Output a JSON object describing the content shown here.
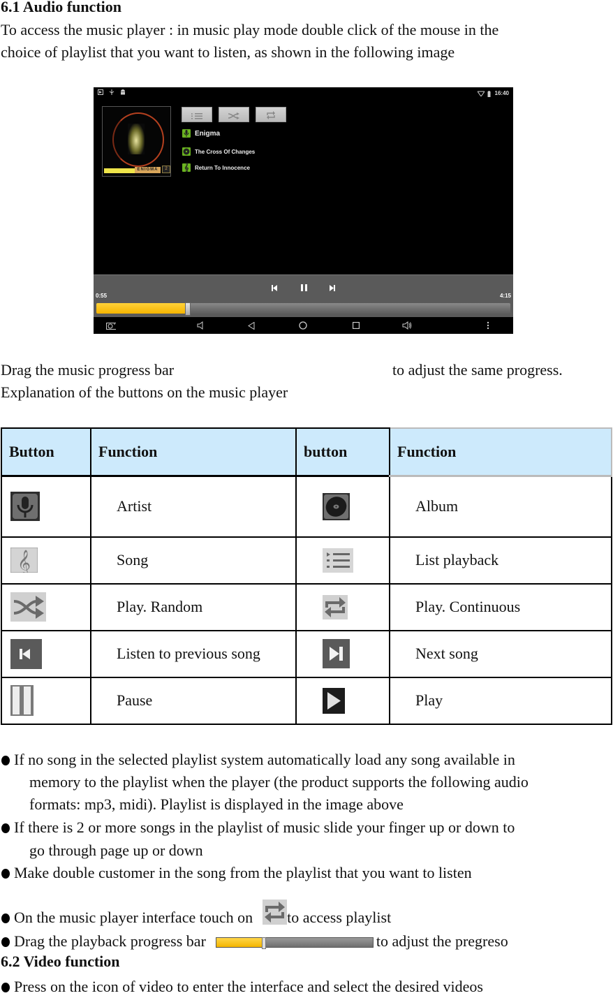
{
  "section_audio": {
    "heading": "6.1 Audio function",
    "intro_line1": "To access the music player : in music play mode double click of the mouse in the",
    "intro_line2": "choice of playlist that you want to listen, as shown in the following image"
  },
  "player": {
    "status_time": "16:40",
    "status_icons_left": [
      "screenshot-icon",
      "usb-icon",
      "android-icon"
    ],
    "status_icons_right": [
      "wifi-icon",
      "battery-icon"
    ],
    "album_art": {
      "title_text": "ENIGMA",
      "number_text": "2",
      "colors": {
        "ring": "#b4401f",
        "band_yellow": "#efe54a",
        "band_orange": "#d9a65b"
      }
    },
    "mode_buttons": [
      {
        "name": "list-playback",
        "icon": "list-icon"
      },
      {
        "name": "shuffle",
        "icon": "shuffle-icon"
      },
      {
        "name": "repeat",
        "icon": "repeat-icon"
      }
    ],
    "items": [
      {
        "icon": "microphone-icon",
        "label": "Enigma",
        "type": "artist"
      },
      {
        "icon": "disc-icon",
        "label": "The Cross Of Changes",
        "type": "album"
      },
      {
        "icon": "treble-clef-icon",
        "label": "Return To Innocence",
        "type": "song"
      }
    ],
    "accent_color": "#6ab320",
    "elapsed": "0:55",
    "duration": "4:15",
    "progress_fraction": 0.22,
    "progress_color": "#f5b400",
    "nav_icons": [
      "camera-icon",
      "volume-down-icon",
      "back-icon",
      "home-icon",
      "recents-icon",
      "volume-up-icon",
      "more-icon"
    ]
  },
  "progress_sentence": {
    "before": "Drag the music progress bar",
    "after": "to adjust the same progress."
  },
  "explanation": "Explanation of the buttons on the music player",
  "table": {
    "headers": [
      "Button",
      "Function",
      "button",
      "Function"
    ],
    "header_bg": "#cdeafc",
    "rows": [
      {
        "left_icon": "microphone-icon",
        "left_fn": "Artist",
        "right_icon": "disc-icon",
        "right_fn": "Album"
      },
      {
        "left_icon": "treble-clef-icon",
        "left_fn": "Song",
        "right_icon": "list-icon",
        "right_fn": "List playback"
      },
      {
        "left_icon": "shuffle-icon",
        "left_fn": "Play. Random",
        "right_icon": "repeat-icon",
        "right_fn": "Play. Continuous"
      },
      {
        "left_icon": "previous-icon",
        "left_fn": "Listen to previous song",
        "right_icon": "next-icon",
        "right_fn": "Next song"
      },
      {
        "left_icon": "pause-icon",
        "left_fn": "Pause",
        "right_icon": "play-icon",
        "right_fn": "Play"
      }
    ]
  },
  "bullets": {
    "b1_line1": "If no song in the selected playlist system automatically load any song available in",
    "b1_line2": "memory to the playlist when the player (the product supports the following audio",
    "b1_line3": "formats: mp3, midi). Playlist is displayed in the image above",
    "b2_line1": "If there is 2 or more songs in the playlist of music slide your finger up or down to",
    "b2_line2": "go through page up or down",
    "b3": "Make double customer in the song from the playlist that you want to listen",
    "b4_before": "On the music player interface touch on",
    "b4_after": "to access playlist",
    "b5_before": "Drag the playback progress bar",
    "b5_after": "to adjust the pregreso",
    "b5_bar_fraction": 0.3
  },
  "section_video": {
    "heading": "6.2 Video function",
    "b1": "Press on the icon of video to enter the interface and select the desired videos"
  }
}
